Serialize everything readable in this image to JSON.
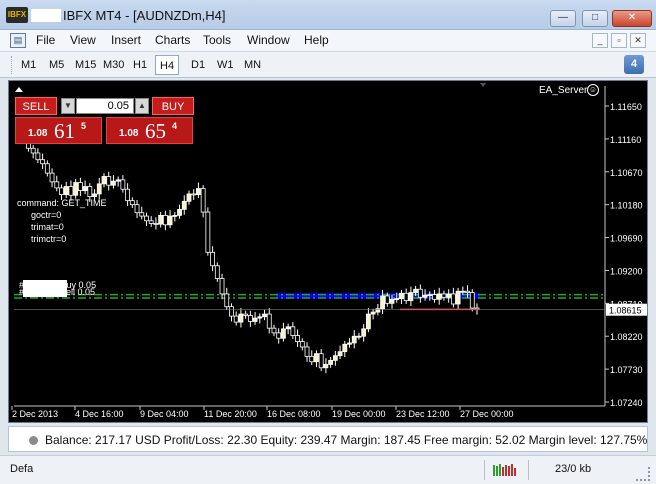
{
  "window": {
    "title": "IBFX MT4 - [AUDNZDm,H4]",
    "app_icon_text": "IBFX"
  },
  "menu": [
    "File",
    "View",
    "Insert",
    "Charts",
    "Tools",
    "Window",
    "Help"
  ],
  "timeframes": {
    "items": [
      "M1",
      "M5",
      "M15",
      "M30",
      "H1",
      "H4",
      "D1",
      "W1",
      "MN"
    ],
    "active": "H4"
  },
  "notifications": {
    "count": "4"
  },
  "trade_panel": {
    "sell_label": "SELL",
    "buy_label": "BUY",
    "lot_size": "0.05",
    "sell_price": {
      "small": "1.08",
      "big": "61",
      "sup": "5"
    },
    "buy_price": {
      "small": "1.08",
      "big": "65",
      "sup": "4"
    }
  },
  "ea": {
    "name": "EA_Server"
  },
  "comment_lines": [
    "command: GET_TIME",
    "goctr=0",
    "trimat=0",
    "trimctr=0"
  ],
  "order_lines": {
    "buy_label": "#9______ buy 0.05",
    "sell_label": "#9______ sell 0.05"
  },
  "colors": {
    "up_candle": "#ffffff",
    "bull_fill": "#f7f3c8",
    "grid_green": "#2aa52a",
    "highlight": "#0000ff",
    "ask_line": "#ff4c4c",
    "chart_bg": "#000000"
  },
  "chart_data": {
    "type": "candlestick",
    "symbol": "AUDNZDm",
    "timeframe": "H4",
    "y_ticks": [
      "1.11650",
      "1.11160",
      "1.10670",
      "1.10180",
      "1.09690",
      "1.09200",
      "1.08710",
      "1.08220",
      "1.07730",
      "1.07240"
    ],
    "ylim": [
      1.0724,
      1.1165
    ],
    "current_price": "1.08615",
    "x_ticks": [
      "2 Dec 2013",
      "4 Dec 16:00",
      "9 Dec 04:00",
      "11 Dec 20:00",
      "16 Dec 08:00",
      "19 Dec 00:00",
      "23 Dec 12:00",
      "27 Dec 00:00"
    ],
    "horizontal_lines": {
      "entry_level_upper": 1.0884,
      "entry_level_lower": 1.0879
    },
    "highlight_band": {
      "from": 1.0878,
      "to": 1.0886
    },
    "ask_line_level": 1.0862,
    "close_series": [
      1.1125,
      1.1118,
      1.1102,
      1.1095,
      1.1085,
      1.1079,
      1.1065,
      1.1052,
      1.1043,
      1.1033,
      1.1045,
      1.1032,
      1.1051,
      1.1039,
      1.1045,
      1.103,
      1.1034,
      1.1049,
      1.106,
      1.1047,
      1.1053,
      1.1055,
      1.1041,
      1.1024,
      1.1018,
      1.1006,
      1.1001,
      1.0994,
      1.099,
      1.0989,
      1.1002,
      1.0988,
      1.1001,
      1.1002,
      1.1011,
      1.1023,
      1.1034,
      1.1033,
      1.1042,
      1.1007,
      1.0947,
      1.0927,
      1.0908,
      1.0885,
      1.0866,
      1.0852,
      1.0843,
      1.0855,
      1.0853,
      1.0844,
      1.0849,
      1.0851,
      1.0855,
      1.0834,
      1.0827,
      1.0819,
      1.0833,
      1.0836,
      1.0823,
      1.0814,
      1.0806,
      1.0792,
      1.0784,
      1.0796,
      1.0775,
      1.078,
      1.0786,
      1.0793,
      1.0799,
      1.081,
      1.0812,
      1.0822,
      1.0822,
      1.0833,
      1.0855,
      1.0858,
      1.0863,
      1.0882,
      1.0871,
      1.0877,
      1.0878,
      1.0886,
      1.0875,
      1.0887,
      1.0892,
      1.088,
      1.0883,
      1.0884,
      1.0877,
      1.0885,
      1.088,
      1.0885,
      1.087,
      1.0889,
      1.0889,
      1.0887,
      1.0864,
      1.0862
    ]
  },
  "status": {
    "text": "Balance: 217.17 USD  Profit/Loss: 22.30  Equity: 239.47  Margin: 187.45  Free margin: 52.02  Margin level: 127.75%"
  },
  "bottom": {
    "left_text": "Defa",
    "traffic": "23/0 kb"
  }
}
